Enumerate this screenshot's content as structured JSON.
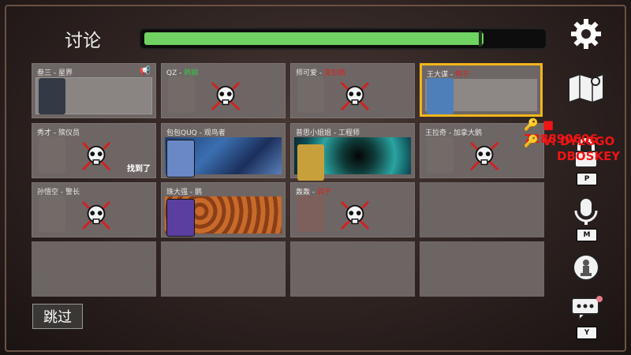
{
  "title": "讨论",
  "timer": {
    "progress": 0.85
  },
  "cards": [
    {
      "name": "叁三",
      "role": "星界",
      "role_color": "white",
      "state": "speaking",
      "icon": "megaphone-icon"
    },
    {
      "name": "QZ",
      "role": "鹈鹕",
      "role_color": "green",
      "state": "dead"
    },
    {
      "name": "师可爱",
      "role": "变形鹅",
      "role_color": "red",
      "state": "dead"
    },
    {
      "name": "王大谋",
      "role": "鸭子",
      "role_color": "red",
      "state": "alive-highlight"
    },
    {
      "name": "秀才",
      "role": "殡仪员",
      "role_color": "white",
      "state": "dead",
      "found": "找到了"
    },
    {
      "name": "包包QUQ",
      "role": "观鸟者",
      "role_color": "white",
      "state": "alive"
    },
    {
      "name": "普思小姐姐",
      "role": "工程师",
      "role_color": "white",
      "state": "alive"
    },
    {
      "name": "王拉奇",
      "role": "加拿大鹅",
      "role_color": "white",
      "state": "dead"
    },
    {
      "name": "孙悟空",
      "role": "警长",
      "role_color": "white",
      "state": "dead"
    },
    {
      "name": "珠大强",
      "role": "鹅",
      "role_color": "white",
      "state": "alive"
    },
    {
      "name": "轰轰",
      "role": "鸽子",
      "role_color": "red",
      "state": "dead"
    }
  ],
  "skip_label": "跳过",
  "sidebar": {
    "settings_icon": "gear-icon",
    "map_icon": "map-icon",
    "lock_icon": "lock-icon",
    "lock_key": "P",
    "mic_icon": "microphone-icon",
    "mic_key": "M",
    "pawn_icon": "pawn-icon",
    "chat_icon": "chat-icon",
    "chat_key": "Y"
  },
  "overlay": {
    "line1": "728890606",
    "line2": "DYLGGO",
    "line3": "DBOSKEY",
    "line2_prefix": "V:"
  }
}
